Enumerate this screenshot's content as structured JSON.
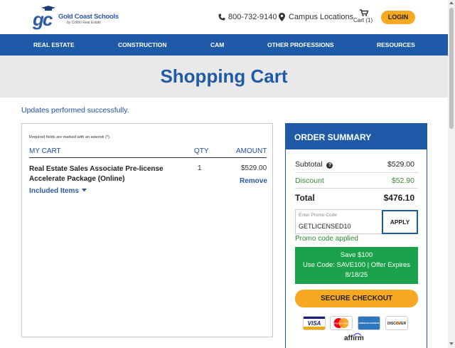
{
  "header": {
    "logo_mark": "gc",
    "logo_name": "Gold Coast Schools",
    "logo_sub": "by Colibri Real Estate",
    "phone": "800-732-9140",
    "campus": "Campus Locations",
    "cart_label": "Cart (1)",
    "login": "LOGIN",
    "icons": {
      "phone": "phone-icon",
      "campus": "map-pin-icon",
      "cart": "shopping-cart-icon"
    }
  },
  "nav": {
    "items": [
      {
        "label": "REAL ESTATE"
      },
      {
        "label": "CONSTRUCTION"
      },
      {
        "label": "CAM"
      },
      {
        "label": "OTHER PROFESSIONS"
      },
      {
        "label": "RESOURCES"
      }
    ]
  },
  "page": {
    "title": "Shopping Cart",
    "success_message": "Updates performed successfully."
  },
  "cart": {
    "required_note": "Required fields are marked with an asterisk (*).",
    "columns": {
      "my_cart": "MY CART",
      "qty": "QTY",
      "amount": "AMOUNT"
    },
    "items": [
      {
        "name": "Real Estate Sales Associate Pre-license Accelerate Package (Online)",
        "qty": "1",
        "amount": "$529.00",
        "remove": "Remove",
        "included": "Included Items"
      }
    ]
  },
  "summary": {
    "title": "ORDER SUMMARY",
    "subtotal_label": "Subtotal",
    "subtotal": "$529.00",
    "discount_label": "Discount",
    "discount": "$52.90",
    "total_label": "Total",
    "total": "$476.10",
    "promo_placeholder": "Enter Promo Code",
    "promo_value": "GETLICENSED10",
    "apply": "APPLY",
    "promo_applied": "Promo code applied",
    "offer_line1": "Save $100",
    "offer_line2": "Use Code: SAVE100 | Offer Expires",
    "offer_line3": "8/18/25",
    "checkout": "SECURE CHECKOUT",
    "cards": [
      "VISA",
      "MasterCard",
      "AMERICAN EXPRESS",
      "DISCOVER"
    ],
    "affirm": "affirm"
  },
  "colors": {
    "brand_blue": "#1f5aa8",
    "accent_orange": "#f7a823",
    "success_green": "#1aa34a",
    "discount_green": "#3b8a3b"
  }
}
